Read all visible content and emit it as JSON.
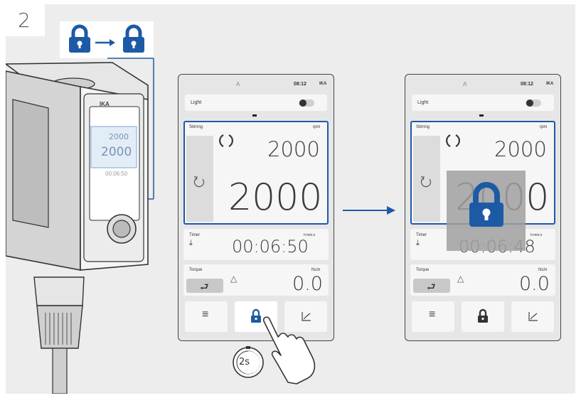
{
  "step_number": "2",
  "device": {
    "brand": "IKA"
  },
  "colors": {
    "accent": "#1d5aa6",
    "background": "#ededed",
    "screen_bg": "#e6e6e6",
    "tile": "#f6f6f6"
  },
  "icons": {
    "lock_before": "lock-icon",
    "arrow": "arrow-right-icon",
    "lock_after": "lock-icon",
    "hand": "pointing-hand-icon",
    "timer": "stopwatch-icon"
  },
  "hold_duration": "2s",
  "screen_left": {
    "status": {
      "tab": "A",
      "time": "08:12",
      "logo": "IKA"
    },
    "light": {
      "label": "Light",
      "state": "off"
    },
    "stirring": {
      "label": "Stirring",
      "unit": "rpm",
      "set_value": "2000",
      "actual_value": "2000"
    },
    "timer": {
      "label": "Timer",
      "unit": "h:min:s",
      "value": "00:06:50"
    },
    "torque": {
      "label": "Torque",
      "unit": "Ncm",
      "value": "0.0"
    },
    "nav": {
      "menu": "menu-icon",
      "lock": "lock-icon",
      "chart": "chart-icon"
    }
  },
  "screen_right": {
    "status": {
      "tab": "A",
      "time": "08:12",
      "logo": "IKA"
    },
    "light": {
      "label": "Light",
      "state": "off"
    },
    "stirring": {
      "label": "Stirring",
      "unit": "rpm",
      "set_value": "2000",
      "actual_value": "2000"
    },
    "timer": {
      "label": "Timer",
      "unit": "h:min:s",
      "value": "00:06:48"
    },
    "torque": {
      "label": "Torque",
      "unit": "Ncm",
      "value": "0.0"
    },
    "nav": {
      "menu": "menu-icon",
      "lock": "lock-icon",
      "chart": "chart-icon"
    },
    "lock_overlay": "lock-icon"
  },
  "device_screen": {
    "set_value": "2000",
    "actual_value": "2000",
    "timer": "00:06:50"
  }
}
